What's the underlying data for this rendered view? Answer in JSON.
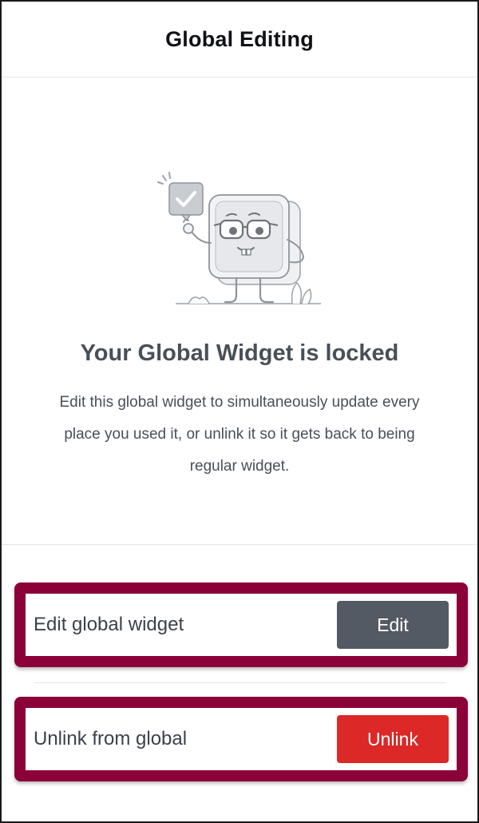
{
  "header": {
    "title": "Global Editing"
  },
  "locked": {
    "title": "Your Global Widget is locked",
    "description": "Edit this global widget to simultaneously update every place you used it, or unlink it so it gets back to being regular widget."
  },
  "actions": [
    {
      "label": "Edit global widget",
      "button_label": "Edit",
      "button_color": "#545a63"
    },
    {
      "label": "Unlink from global",
      "button_label": "Unlink",
      "button_color": "#dc2827"
    }
  ],
  "colors": {
    "highlight_border": "#8c0039",
    "text_dark": "#0f1115",
    "text_muted": "#4a4f57"
  },
  "icons": {
    "illustration": "locked-widget-character-illustration",
    "check": "check-icon"
  }
}
